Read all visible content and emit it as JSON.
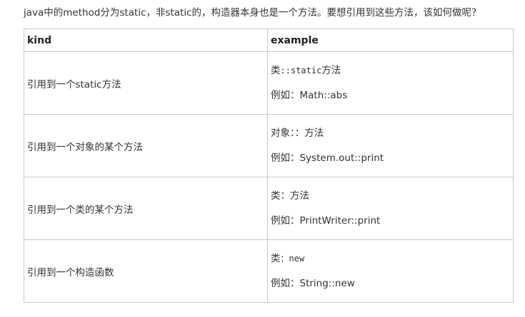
{
  "intro": "java中的method分为static，非static的，构造器本身也是一个方法。要想引用到这些方法，该如何做呢？",
  "table": {
    "headers": [
      "kind",
      "example"
    ],
    "rows": [
      {
        "kind": "引用到一个static方法",
        "example_prefix": "类",
        "example_code": "::static",
        "example_suffix": "方法",
        "example": "例如：Math::abs"
      },
      {
        "kind": "引用到一个对象的某个方法",
        "example_prefix": "对象",
        "example_code": "：：",
        "example_suffix": "方法",
        "example": "例如：System.out::print"
      },
      {
        "kind": "引用到一个类的某个方法",
        "example_prefix": "类",
        "example_code": "：",
        "example_suffix": "方法",
        "example": "例如：PrintWriter::print"
      },
      {
        "kind": "引用到一个构造函数",
        "example_prefix": "类",
        "example_code": "：new",
        "example_suffix": "",
        "example": "例如：String::new"
      }
    ]
  }
}
